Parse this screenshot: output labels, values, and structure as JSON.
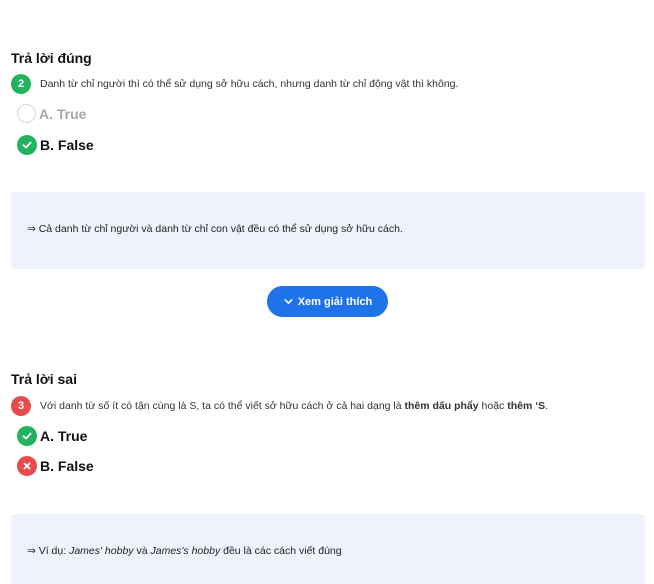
{
  "colors": {
    "green": "#22b35e",
    "red": "#e74c4c",
    "blue": "#1f73e8",
    "panel": "#eef2fb"
  },
  "q2": {
    "section": "Trả lời đúng",
    "number": "2",
    "question": "Danh từ chỉ người thì có thể sử dụng sở hữu cách, nhưng danh từ chỉ động vật thì không.",
    "optA": "A. True",
    "optB": "B. False",
    "explanation": "⇒ Cả danh từ chỉ người và danh từ chỉ con vật đều có thể sử dụng sở hữu cách.",
    "button": "Xem giải thích"
  },
  "q3": {
    "section": "Trả lời sai",
    "number": "3",
    "question_pre": "Với danh từ số ít có tận cùng là S, ta có thể viết sở hữu cách ở cả hai dạng là ",
    "question_bold1": "thêm dấu phẩy",
    "question_mid": " hoặc ",
    "question_bold2": "thêm ‘S",
    "question_end": ".",
    "optA": "A. True",
    "optB": "B. False",
    "expl_pre": "⇒ Ví dụ: ",
    "expl_it1": "James' hobby",
    "expl_mid": " và ",
    "expl_it2": "James's hobby",
    "expl_end": " đều là các cách viết đúng"
  }
}
